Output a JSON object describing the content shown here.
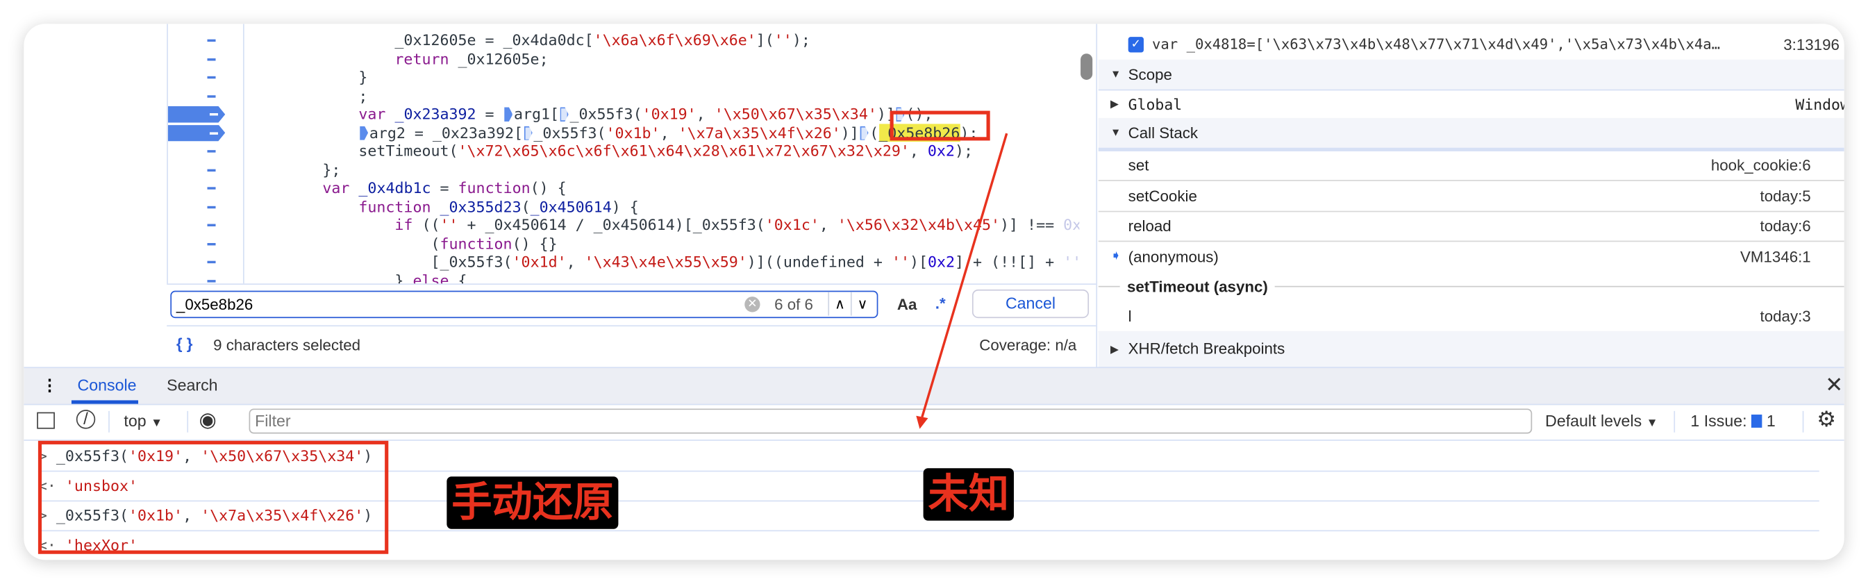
{
  "editor": {
    "lines": [
      {
        "indent": 16,
        "bp": false,
        "tokens": [
          [
            "_0x12605e = _0x4da0dc[",
            ""
          ],
          [
            "'\\x6a\\x6f\\x69\\x6e'",
            "str"
          ],
          [
            "](",
            ""
          ],
          [
            "''",
            "str"
          ],
          [
            ");",
            ""
          ]
        ]
      },
      {
        "indent": 16,
        "bp": false,
        "tokens": [
          [
            "return",
            "kw"
          ],
          [
            " _0x12605e;",
            ""
          ]
        ]
      },
      {
        "indent": 12,
        "bp": false,
        "tokens": [
          [
            "}",
            ""
          ]
        ]
      },
      {
        "indent": 12,
        "bp": false,
        "tokens": [
          [
            ";",
            ""
          ]
        ]
      },
      {
        "indent": 12,
        "bp": true,
        "tokens": [
          [
            "var",
            "kw"
          ],
          [
            " ",
            ""
          ],
          [
            "_0x23a392",
            "def"
          ],
          [
            " = ",
            ""
          ],
          [
            "",
            "bp"
          ],
          [
            "arg1[",
            ""
          ],
          [
            "",
            "bph"
          ],
          [
            "_0x55f3(",
            ""
          ],
          [
            "'0x19'",
            "str"
          ],
          [
            ", ",
            ""
          ],
          [
            "'\\x50\\x67\\x35\\x34'",
            "str"
          ],
          [
            ")]",
            ""
          ],
          [
            "",
            "bph"
          ],
          [
            "();",
            ""
          ]
        ]
      },
      {
        "indent": 12,
        "bp": true,
        "tokens": [
          [
            "",
            "bp"
          ],
          [
            "arg2 = _0x23a392[",
            ""
          ],
          [
            "",
            "bph"
          ],
          [
            "_0x55f3(",
            ""
          ],
          [
            "'0x1b'",
            "str"
          ],
          [
            ", ",
            ""
          ],
          [
            "'\\x7a\\x35\\x4f\\x26'",
            "str"
          ],
          [
            ")]",
            ""
          ],
          [
            "",
            "bph"
          ],
          [
            "(",
            ""
          ],
          [
            "_0x5e8b26",
            "hl"
          ],
          [
            ");",
            ""
          ]
        ]
      },
      {
        "indent": 12,
        "bp": false,
        "tokens": [
          [
            "setTimeout(",
            ""
          ],
          [
            "'\\x72\\x65\\x6c\\x6f\\x61\\x64\\x28\\x61\\x72\\x67\\x32\\x29'",
            "str"
          ],
          [
            ", ",
            ""
          ],
          [
            "0x2",
            "num"
          ],
          [
            ");",
            ""
          ]
        ]
      },
      {
        "indent": 8,
        "bp": false,
        "tokens": [
          [
            "};",
            ""
          ]
        ]
      },
      {
        "indent": 8,
        "bp": false,
        "tokens": [
          [
            "var",
            "kw"
          ],
          [
            " ",
            ""
          ],
          [
            "_0x4db1c",
            "def"
          ],
          [
            " = ",
            ""
          ],
          [
            "function",
            "kw"
          ],
          [
            "() {",
            ""
          ]
        ]
      },
      {
        "indent": 12,
        "bp": false,
        "tokens": [
          [
            "function",
            "kw"
          ],
          [
            " ",
            ""
          ],
          [
            "_0x355d23",
            "def"
          ],
          [
            "(",
            ""
          ],
          [
            "_0x450614",
            "def"
          ],
          [
            ") {",
            ""
          ]
        ]
      },
      {
        "indent": 16,
        "bp": false,
        "tokens": [
          [
            "if",
            "kw"
          ],
          [
            " ((",
            ""
          ],
          [
            "''",
            "str"
          ],
          [
            " + _0x450614 / _0x450614)[_0x55f3(",
            ""
          ],
          [
            "'0x1c'",
            "str"
          ],
          [
            ", ",
            ""
          ],
          [
            "'\\x56\\x32\\x4b\\x45'",
            "str"
          ],
          [
            ")] !== ",
            ""
          ],
          [
            "0x",
            "fade"
          ]
        ]
      },
      {
        "indent": 20,
        "bp": false,
        "tokens": [
          [
            "(",
            ""
          ],
          [
            "function",
            "kw"
          ],
          [
            "() {}",
            ""
          ]
        ]
      },
      {
        "indent": 20,
        "bp": false,
        "tokens": [
          [
            "[_0x55f3(",
            ""
          ],
          [
            "'0x1d'",
            "str"
          ],
          [
            ", ",
            ""
          ],
          [
            "'\\x43\\x4e\\x55\\x59'",
            "str"
          ],
          [
            ")]((undefined + ",
            ""
          ],
          [
            "''",
            "str"
          ],
          [
            ")[",
            ""
          ],
          [
            "0x2",
            "num"
          ],
          [
            "] + (!![] + ",
            ""
          ],
          [
            "''",
            "fade"
          ]
        ]
      },
      {
        "indent": 16,
        "bp": false,
        "tokens": [
          [
            "} ",
            ""
          ],
          [
            "else",
            "kw"
          ],
          [
            " {",
            ""
          ]
        ]
      }
    ]
  },
  "search": {
    "value": "_0x5e8b26",
    "count": "6 of 6",
    "case_label": "Aa",
    "regex_label": ".*",
    "cancel_label": "Cancel"
  },
  "status": {
    "selection": "9 characters selected",
    "coverage": "Coverage: n/a",
    "pretty_icon": "{ }"
  },
  "right": {
    "breakpoint": {
      "checked": true,
      "code": "var _0x4818=['\\x63\\x73\\x4b\\x48\\x77\\x71\\x4d\\x49','\\x5a\\x73\\x4b\\x4a…",
      "location": "3:13196"
    },
    "scope_label": "Scope",
    "global": {
      "name": "Global",
      "value": "Window"
    },
    "callstack_label": "Call Stack",
    "frames": [
      {
        "name": "set",
        "loc": "hook_cookie:6"
      },
      {
        "name": "setCookie",
        "loc": "today:5"
      },
      {
        "name": "reload",
        "loc": "today:6"
      },
      {
        "name": "(anonymous)",
        "loc": "VM1346:1",
        "current": true
      }
    ],
    "async_label": "setTimeout (async)",
    "async_frame": {
      "name": "l",
      "loc": "today:3"
    },
    "xhr_label": "XHR/fetch Breakpoints"
  },
  "drawer": {
    "tabs": [
      "Console",
      "Search"
    ],
    "context": "top",
    "filter_placeholder": "Filter",
    "levels": "Default levels",
    "issues_label": "1 Issue:",
    "issues_count": "1"
  },
  "console": {
    "entries": [
      {
        "kind": "input",
        "prefix": ">",
        "plain": "_0x55f3(",
        "a": "'0x19'",
        "mid": ", ",
        "b": "'\\x50\\x67\\x35\\x34'",
        "end": ")"
      },
      {
        "kind": "output",
        "prefix": "<·",
        "value": "'unsbox'"
      },
      {
        "kind": "input",
        "prefix": ">",
        "plain": "_0x55f3(",
        "a": "'0x1b'",
        "mid": ", ",
        "b": "'\\x7a\\x35\\x4f\\x26'",
        "end": ")"
      },
      {
        "kind": "output",
        "prefix": "<·",
        "value": "'hexXor'"
      }
    ]
  },
  "annotations": {
    "manual": "手动还原",
    "unknown": "未知",
    "color": "#e8321e"
  }
}
